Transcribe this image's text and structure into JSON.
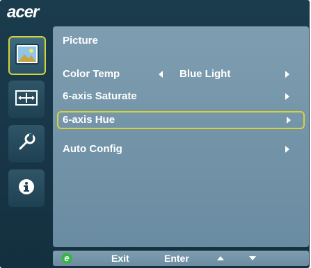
{
  "brand": {
    "logo_text": "acer"
  },
  "sidebar": {
    "items": [
      {
        "icon": "picture-icon",
        "active": true
      },
      {
        "icon": "image-position-icon",
        "active": false
      },
      {
        "icon": "settings-tool-icon",
        "active": false
      },
      {
        "icon": "info-icon",
        "active": false
      }
    ]
  },
  "panel": {
    "title": "Picture",
    "rows": [
      {
        "label": "Color Temp",
        "value": "Blue Light",
        "has_left_arrow": true
      },
      {
        "label": "6-axis Saturate",
        "value": ""
      },
      {
        "label": "6-axis Hue",
        "value": "",
        "selected": true
      },
      {
        "label": "Auto Config",
        "value": ""
      }
    ]
  },
  "bottom_bar": {
    "exit_icon_text": "e",
    "exit_label": "Exit",
    "enter_label": "Enter"
  },
  "colors": {
    "highlight": "#d7d23a",
    "panel_bg": "#7394a8",
    "frame_bg": "#173546",
    "exit_icon": "#3bb34a"
  }
}
